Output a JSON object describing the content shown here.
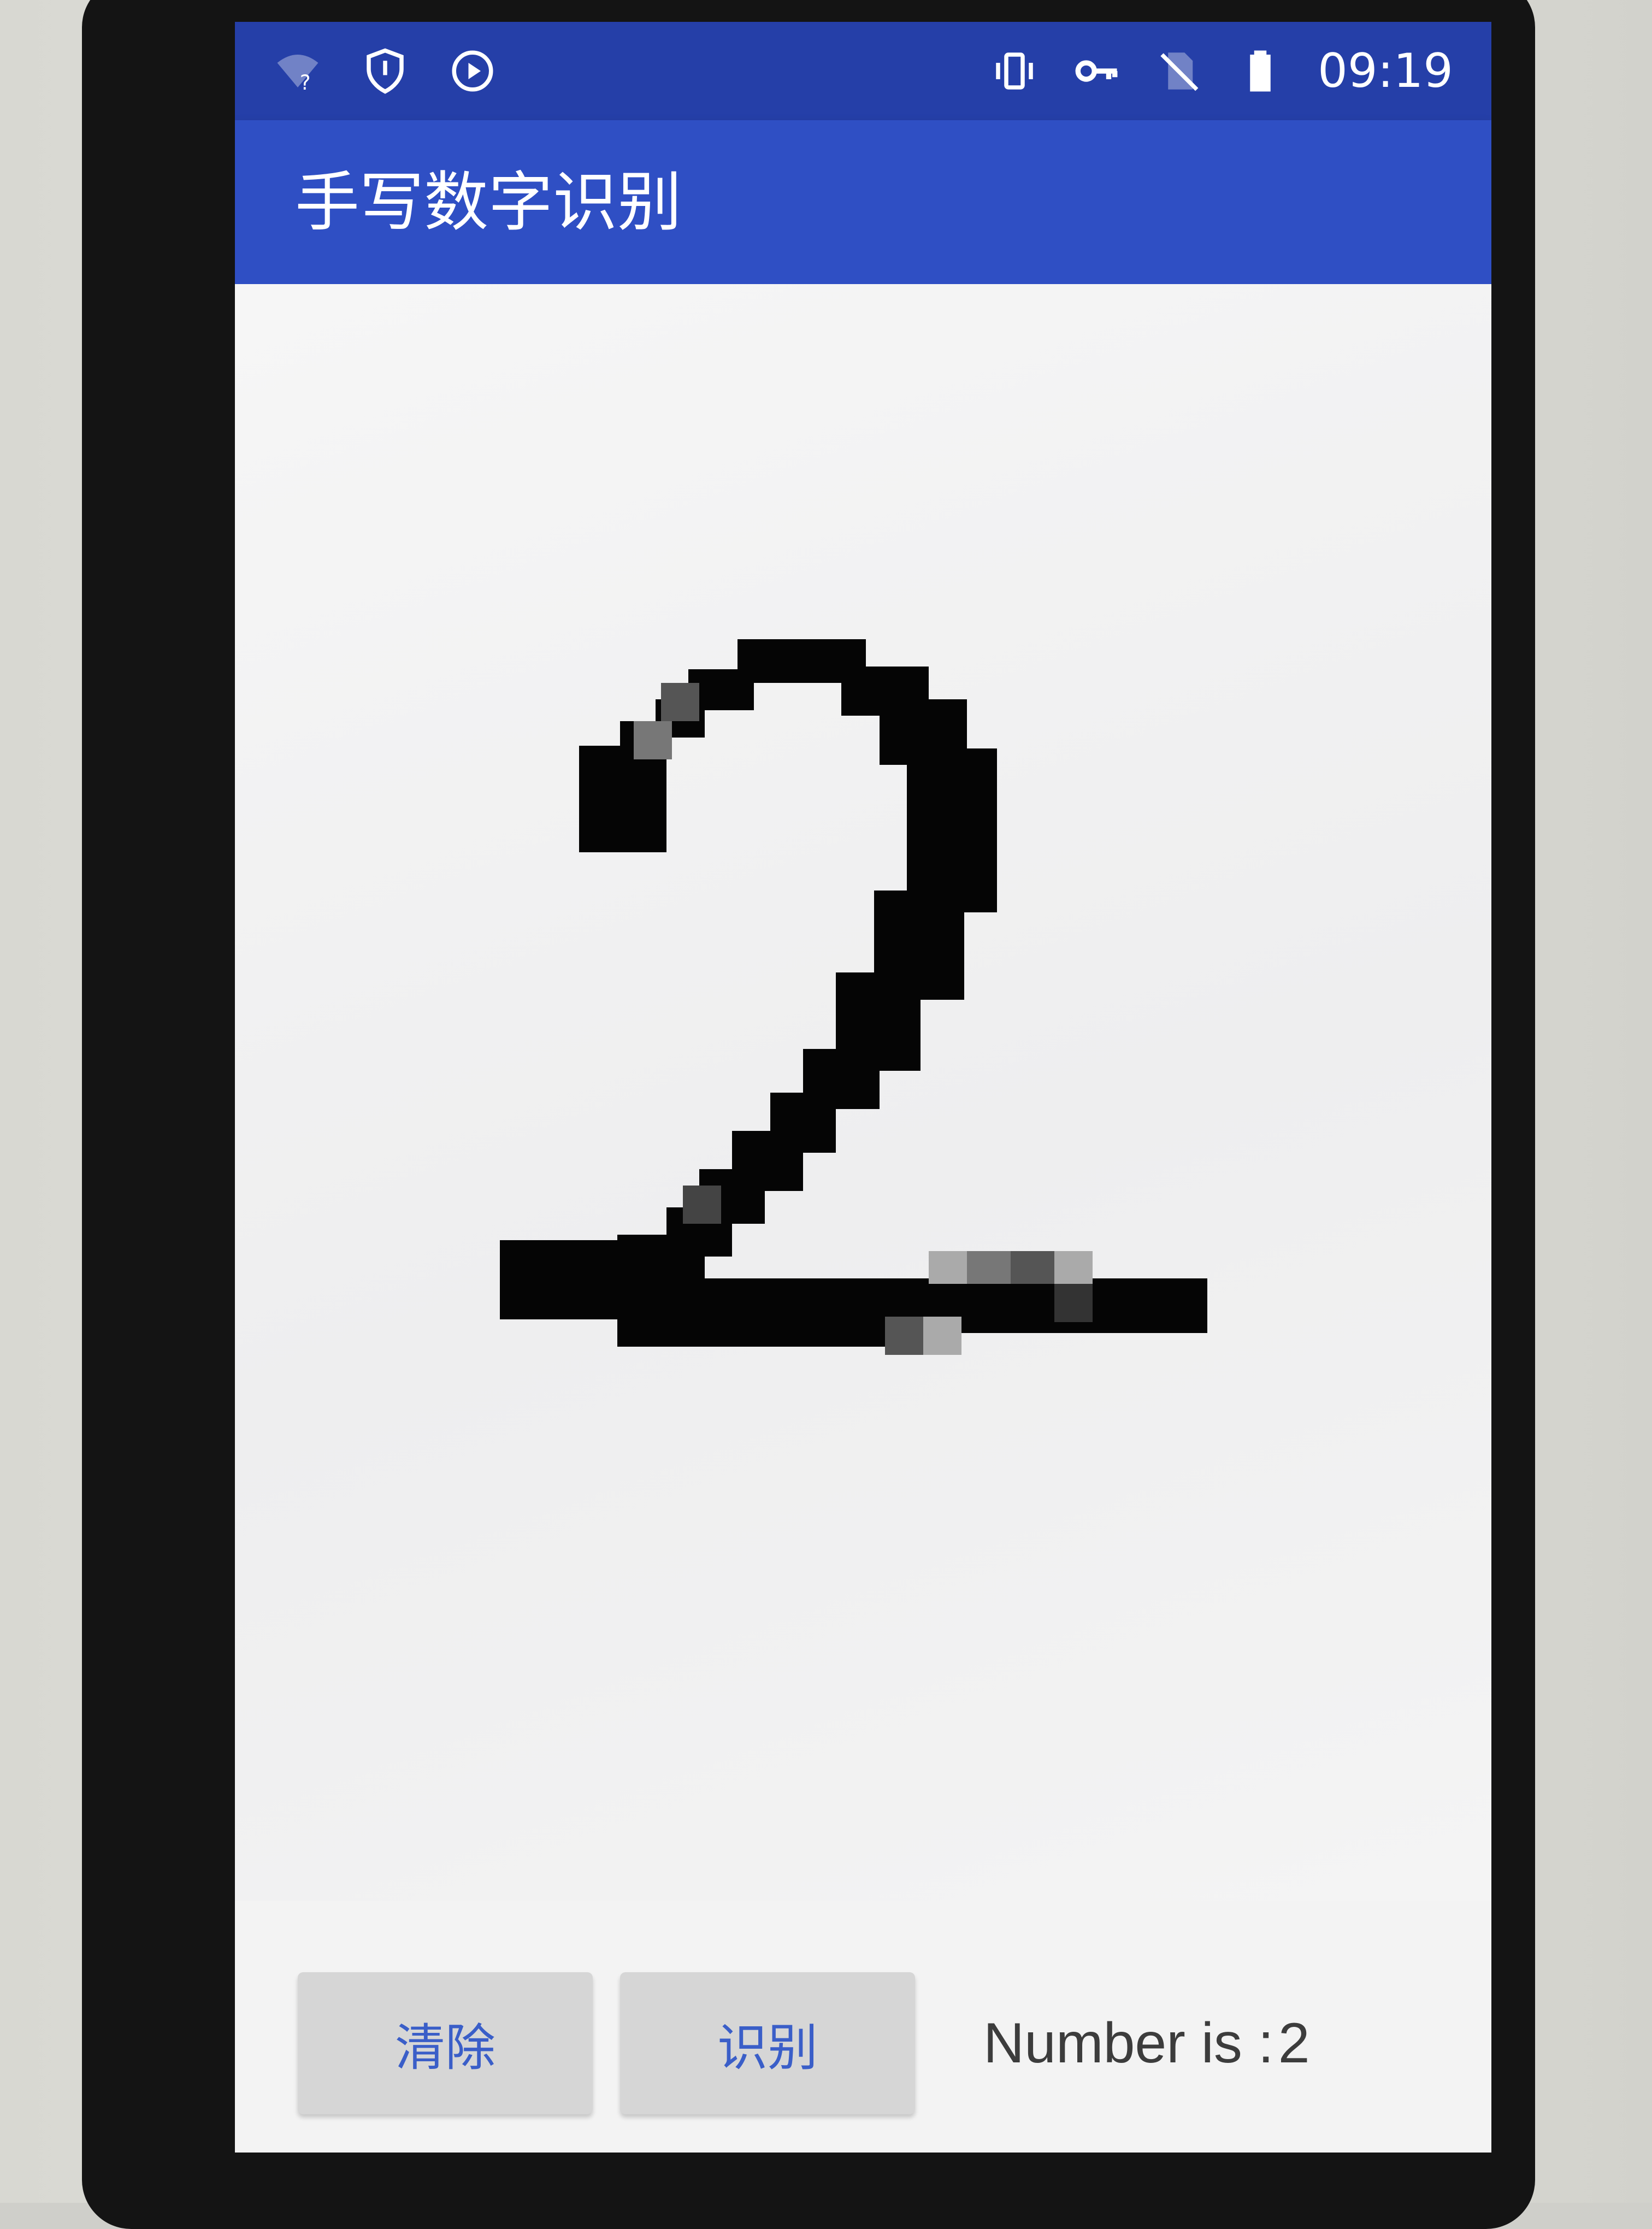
{
  "status_bar": {
    "time": "09:19",
    "icons": [
      "wifi-unknown-icon",
      "vpn-shield-icon",
      "media-play-icon",
      "vibrate-icon",
      "vpn-key-icon",
      "no-sim-icon",
      "battery-icon"
    ]
  },
  "app_bar": {
    "title": "手写数字识别"
  },
  "canvas": {
    "drawn_digit": "2"
  },
  "buttons": {
    "clear_label": "清除",
    "recognize_label": "识别"
  },
  "result": {
    "prefix": "Number is :",
    "value": "2"
  },
  "colors": {
    "status_bar": "#253fa8",
    "app_bar": "#2f4fc4",
    "button_text": "#3a5ec8",
    "button_bg": "#d6d6d6",
    "ink": "#050505"
  }
}
